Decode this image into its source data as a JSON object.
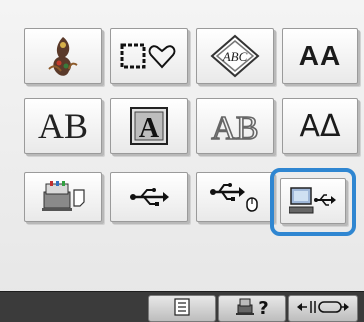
{
  "pattern_grid": {
    "row1": [
      {
        "icon": "peacock-embroidery-icon"
      },
      {
        "icon": "frame-heart-shapes-icon"
      },
      {
        "icon": "monogram-abc-icon",
        "text": "ABC"
      },
      {
        "icon": "alphabet-font-icon",
        "text": "AA"
      }
    ],
    "row2": [
      {
        "icon": "decorative-alphabet-icon",
        "text": "AB"
      },
      {
        "icon": "framed-letter-icon",
        "text": "A"
      },
      {
        "icon": "outlined-letters-icon",
        "text": "AB"
      },
      {
        "icon": "greek-letters-icon",
        "text": "AΔ"
      }
    ],
    "row3": [
      {
        "icon": "embroidery-machine-memory-icon"
      },
      {
        "icon": "usb-icon"
      },
      {
        "icon": "usb-mouse-icon"
      },
      {
        "icon": "computer-usb-icon",
        "selected": true
      }
    ]
  },
  "bottom_bar": {
    "help_label": "?",
    "colors": {
      "bar": "#3b3b3b",
      "selection": "#2f86d1"
    }
  }
}
